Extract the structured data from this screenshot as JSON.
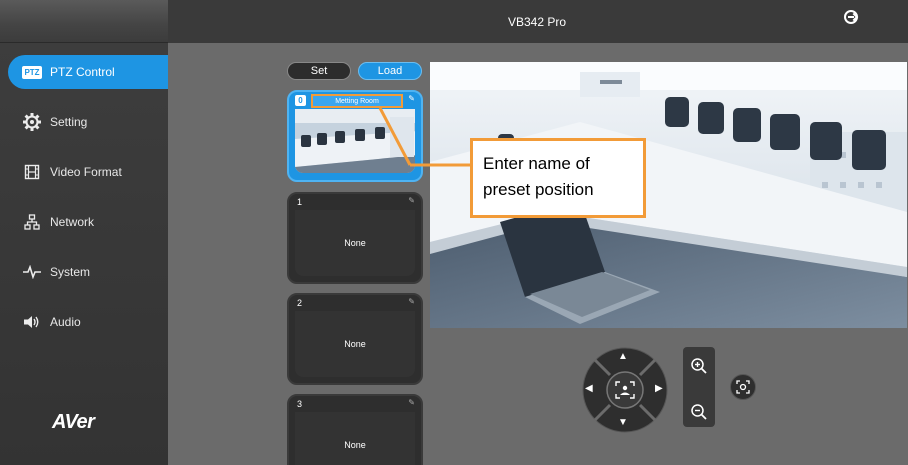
{
  "header": {
    "title": "VB342 Pro",
    "logout_icon": "logout-icon"
  },
  "brand": {
    "logo_text": "AVer"
  },
  "sidebar": {
    "items": [
      {
        "label": "PTZ Control",
        "icon": "ptz-icon",
        "badge": "PTZ",
        "active": true
      },
      {
        "label": "Setting",
        "icon": "gear-icon",
        "active": false
      },
      {
        "label": "Video Format",
        "icon": "film-icon",
        "active": false
      },
      {
        "label": "Network",
        "icon": "network-icon",
        "active": false
      },
      {
        "label": "System",
        "icon": "pulse-icon",
        "active": false
      },
      {
        "label": "Audio",
        "icon": "speaker-icon",
        "active": false
      }
    ]
  },
  "preset_controls": {
    "set_label": "Set",
    "load_label": "Load"
  },
  "presets": [
    {
      "number": "0",
      "name": "Metting Room",
      "selected": true
    },
    {
      "number": "1",
      "name": "None",
      "selected": false
    },
    {
      "number": "2",
      "name": "None",
      "selected": false
    },
    {
      "number": "3",
      "name": "None",
      "selected": false
    }
  ],
  "callout": {
    "line1": "Enter name of",
    "line2": "preset position"
  },
  "colors": {
    "accent": "#1e95e3",
    "callout_border": "#f29b38",
    "sidebar": "#3a3a3a",
    "main_bg": "#6b6b6b"
  }
}
